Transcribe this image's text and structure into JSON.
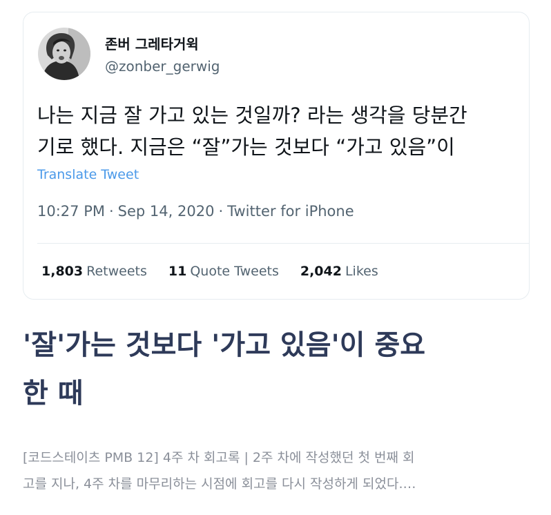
{
  "tweet": {
    "author": {
      "display_name": "존버 그레타거윅",
      "handle": "@zonber_gerwig",
      "avatar_icon": "profile-photo"
    },
    "text_lines": [
      "나는 지금 잘 가고 있는 것일까? 라는 생각을 당분간",
      "기로 했다. 지금은 “잘”가는 것보다 “가고 있음”이"
    ],
    "translate_label": "Translate Tweet",
    "time": "10:27 PM",
    "date": "Sep 14, 2020",
    "source": "Twitter for iPhone",
    "separator": "·",
    "stats": {
      "retweets_count": "1,803",
      "retweets_label": "Retweets",
      "quote_count": "11",
      "quote_label": "Quote Tweets",
      "likes_count": "2,042",
      "likes_label": "Likes"
    }
  },
  "article": {
    "title_lines": [
      "'잘'가는 것보다 '가고 있음'이 중요",
      "한 때"
    ],
    "description_lines": [
      "[코드스테이츠 PMB 12] 4주 차 회고록 | 2주 차에 작성했던 첫 번째 회",
      "고를 지나, 4주 차를 마무리하는 시점에 회고를 다시 작성하게 되었다.…"
    ]
  },
  "colors": {
    "link": "#4a99e9",
    "title": "#2e3a59",
    "muted": "#536471"
  }
}
